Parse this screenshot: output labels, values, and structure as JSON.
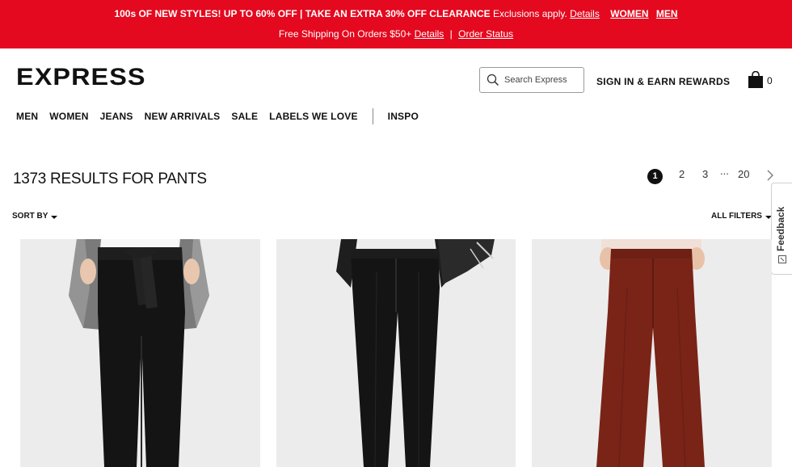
{
  "promo": {
    "line1_strong": "100s OF NEW STYLES! UP TO 60% OFF | TAKE AN EXTRA 30% OFF CLEARANCE",
    "line1_light": "Exclusions apply.",
    "details_link": "Details",
    "women_link": "WOMEN",
    "men_link": "MEN",
    "line2_text": "Free Shipping On Orders $50+",
    "line2_details_link": "Details",
    "line2_separator": "|",
    "order_status_link": "Order Status"
  },
  "header": {
    "logo": "EXPRESS",
    "search_placeholder": "Search Express",
    "signin_label": "SIGN IN & EARN REWARDS",
    "bag_count": "0"
  },
  "nav": {
    "items": [
      "MEN",
      "WOMEN",
      "JEANS",
      "NEW ARRIVALS",
      "SALE",
      "LABELS WE LOVE"
    ],
    "inspo": "INSPO"
  },
  "results": {
    "title": "1373 RESULTS FOR PANTS",
    "sort_label": "SORT BY",
    "filters_label": "ALL FILTERS"
  },
  "pagination": {
    "current": "1",
    "pages": [
      "2",
      "3"
    ],
    "ellipsis": "...",
    "last": "20"
  },
  "feedback": {
    "label": "Feedback"
  },
  "colors": {
    "promo_red": "#e4091f",
    "pant_black": "#141414",
    "pant_rust": "#7a2418",
    "blazer_tweed": "#8c8c8c"
  },
  "products": [
    {
      "description_icon": "black-belted-pant-image"
    },
    {
      "description_icon": "black-slim-pant-image"
    },
    {
      "description_icon": "rust-flare-pant-image"
    }
  ]
}
